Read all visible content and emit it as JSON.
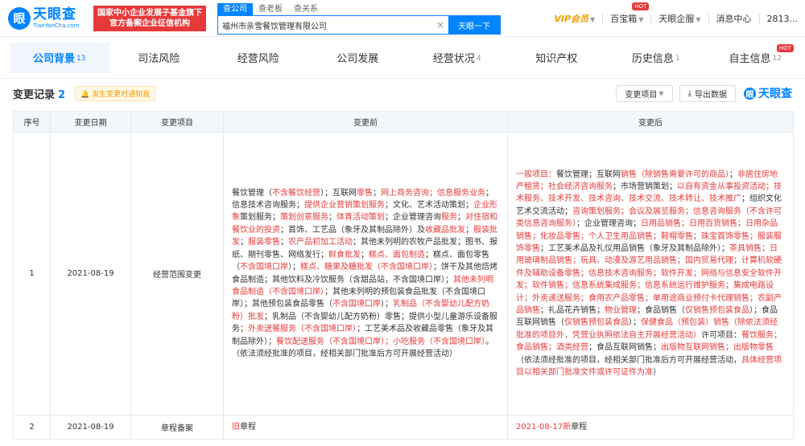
{
  "brand": {
    "name": "天眼查",
    "domain": "TianYanCha.com",
    "slogan_line1": "国家中小企业发展子基金旗下",
    "slogan_line2": "官方备案企业征信机构"
  },
  "search": {
    "tabs": [
      "查公司",
      "查老板",
      "查关系"
    ],
    "value": "福州市亲雪餐饮管理有限公司",
    "button": "天眼一下"
  },
  "nav": {
    "vip": "VIP会员",
    "treasure": "百宝箱",
    "hot": "HOT",
    "enterprise": "天眼企服",
    "messages": "消息中心",
    "user": "2813..."
  },
  "tabs": [
    {
      "label": "公司背景",
      "count": "13"
    },
    {
      "label": "司法风险",
      "count": ""
    },
    {
      "label": "经营风险",
      "count": ""
    },
    {
      "label": "公司发展",
      "count": ""
    },
    {
      "label": "经营状况",
      "count": "4"
    },
    {
      "label": "知识产权",
      "count": ""
    },
    {
      "label": "历史信息",
      "count": "1"
    },
    {
      "label": "自主信息",
      "count": "12"
    }
  ],
  "section": {
    "title": "变更记录",
    "count": "2",
    "notice": "发生变更时通知我",
    "filter": "变更项目",
    "export": "导出数据",
    "brand": "天眼查"
  },
  "table": {
    "headers": [
      "序号",
      "变更日期",
      "变更项目",
      "变更前",
      "变更后"
    ],
    "rows": [
      {
        "no": "1",
        "date": "2021-08-19",
        "item": "经营范围变更"
      },
      {
        "no": "2",
        "date": "2021-08-19",
        "item": "章程备案"
      }
    ]
  },
  "before_text": [
    [
      "餐饮管理（",
      "n"
    ],
    [
      "不含餐饮经营",
      "r"
    ],
    [
      "）；互联网",
      "n"
    ],
    [
      "零售",
      "r"
    ],
    [
      "；",
      "n"
    ],
    [
      "网上商务咨询；信息服务业务",
      "r"
    ],
    [
      "；信息技术咨询服务；",
      "n"
    ],
    [
      "提供企业营销策划服务",
      "r"
    ],
    [
      "；文化、艺术活动策划；",
      "n"
    ],
    [
      "企业形象",
      "r"
    ],
    [
      "策划服务；",
      "n"
    ],
    [
      "策划创意服务",
      "r"
    ],
    [
      "；",
      "n"
    ],
    [
      "体育活动策划",
      "r"
    ],
    [
      "；企业管理咨询",
      "n"
    ],
    [
      "服务",
      "r"
    ],
    [
      "；",
      "n"
    ],
    [
      "对住宿和餐饮业的投资",
      "r"
    ],
    [
      "；首饰、工艺品（象牙及其制品除外）及",
      "n"
    ],
    [
      "收藏品批发",
      "r"
    ],
    [
      "；",
      "n"
    ],
    [
      "服装批发",
      "r"
    ],
    [
      "；",
      "n"
    ],
    [
      "服装零售",
      "r"
    ],
    [
      "；",
      "n"
    ],
    [
      "农产品初加工活动",
      "r"
    ],
    [
      "；其他未列明的农牧产品批发；图书、报纸、期刊零售、网络发行；",
      "n"
    ],
    [
      "鲜食批发",
      "r"
    ],
    [
      "；",
      "n"
    ],
    [
      "糕点、面包制造",
      "r"
    ],
    [
      "；糕点、面包零售（",
      "n"
    ],
    [
      "不含国境口岸",
      "r"
    ],
    [
      "）；",
      "n"
    ],
    [
      "糕点、糖果及糖批发（不含国境口岸）",
      "r"
    ],
    [
      "；饼干及其他焙烤食品制造；其他饮料及冷饮服务（含甜品站，不含国境口岸）；",
      "n"
    ],
    [
      "其他未列明食品制造（不含国境口岸）",
      "r"
    ],
    [
      "；其他未列明的预包装食品批发（不含国境口岸）；其他预包装食品零售（",
      "n"
    ],
    [
      "不含国境口岸",
      "r"
    ],
    [
      "）；",
      "n"
    ],
    [
      "乳制品（不含婴幼儿配方奶粉）批发",
      "r"
    ],
    [
      "；乳制品（不含婴幼儿配方奶粉）零售；提供小型儿童游乐设备服务；",
      "n"
    ],
    [
      "外卖送餐服务（不含国境口岸）",
      "r"
    ],
    [
      "；工艺美术品及收藏品零售（象牙及其制品除外）；",
      "n"
    ],
    [
      "餐饮配送服务（不含国境口岸）",
      "r"
    ],
    [
      "；小吃服务（不含国境口岸）",
      "r"
    ],
    [
      "。（依法须经批准的项目，经相关部门批准后方可开展经营活动）",
      "n"
    ]
  ],
  "after_text": [
    [
      "一般项目：",
      "r"
    ],
    [
      "餐饮管理；互联网",
      "n"
    ],
    [
      "销售（除销售需要许可的商品）",
      "r"
    ],
    [
      "；",
      "n"
    ],
    [
      "非居住房地产租赁；社会经济咨询服务",
      "r"
    ],
    [
      "；市场营销策划；",
      "n"
    ],
    [
      "以自有资金从事投资活动；技术服务、技术开发、技术咨询、技术交流、技术转让、技术推广",
      "r"
    ],
    [
      "；组织文化艺术交流活动；",
      "n"
    ],
    [
      "咨询策划服务；会议及展览服务；信息咨询服务（不含许可类信息咨询服务）",
      "r"
    ],
    [
      "；企业管理咨询；",
      "n"
    ],
    [
      "日用品销售；日用百货销售；日用杂品销售；化妆品零售；个人卫生用品销售；鞋帽零售；珠宝首饰零售；服装服饰零售",
      "r"
    ],
    [
      "；工艺美术品及礼仪用品销售（象牙及其制品除外）；",
      "n"
    ],
    [
      "茶具销售；日用玻璃制品销售；玩具、动漫及游艺用品销售；国内贸易代理；计算机软硬件及辅助设备零售；信息技术咨询服务；软件开发；网络与信息安全软件开发；软件销售；信息系统集成服务；信息系统运行维护服务；集成电路设计；外卖递送服务；食用农产品零售；单用途商业预付卡代理销售；农副产品销售",
      "r"
    ],
    [
      "；礼品花卉销售；",
      "n"
    ],
    [
      "物业管理",
      "r"
    ],
    [
      "；食品销售（",
      "n"
    ],
    [
      "仅销售预包装食品",
      "r"
    ],
    [
      "）；食品互联网销售（",
      "n"
    ],
    [
      "仅销售预包装食品",
      "r"
    ],
    [
      "）；",
      "n"
    ],
    [
      "保健食品（预包装）销售",
      "r"
    ],
    [
      "（除依法须经批准的项目外，凭营业执照依法自主开展经营活动）",
      "r"
    ],
    [
      "许可项目：",
      "n"
    ],
    [
      "餐饮服务；食品销售；酒类经营",
      "r"
    ],
    [
      "；食品互联网销售；",
      "n"
    ],
    [
      "出版物互联网销售；出版物零售",
      "r"
    ],
    [
      "（依法须经批准的项目，经相关部门批准后方可开展经营活动，",
      "n"
    ],
    [
      "具体经营项目以相关部门批准文件或许可证件为准",
      "r"
    ],
    [
      "）",
      "n"
    ]
  ],
  "row2_before": [
    [
      "旧",
      "r"
    ],
    [
      "章程",
      "n"
    ]
  ],
  "row2_after": [
    [
      "2021-08-17新",
      "r"
    ],
    [
      "章程",
      "n"
    ]
  ]
}
